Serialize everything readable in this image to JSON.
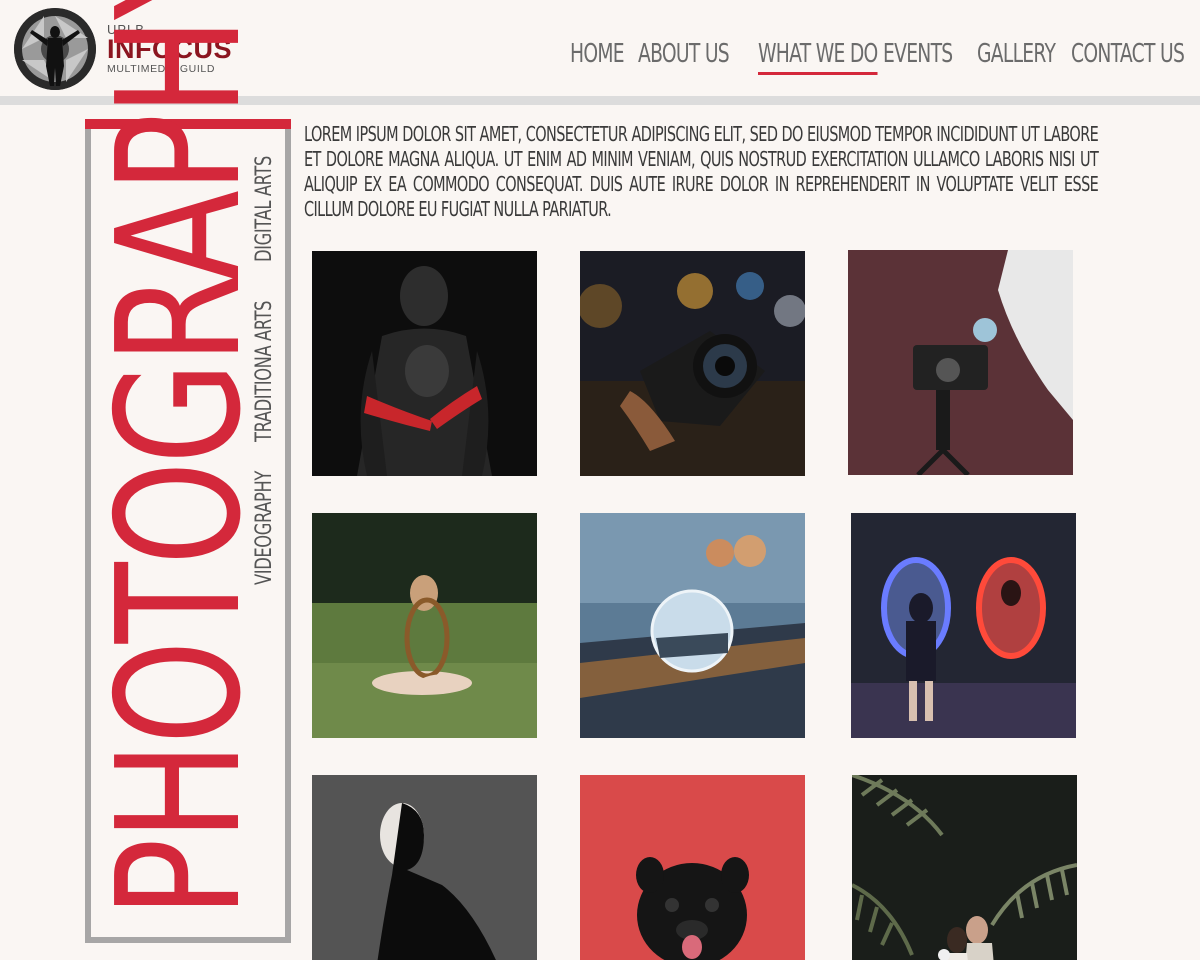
{
  "logo": {
    "line1": "UPLB",
    "line2": "INFOCUS",
    "line3": "MULTIMEDIA GUILD"
  },
  "nav": {
    "items": [
      {
        "label": "HOME",
        "active": false
      },
      {
        "label": "ABOUT US",
        "active": false
      },
      {
        "label": "WHAT WE DO",
        "active": true
      },
      {
        "label": "EVENTS",
        "active": false
      },
      {
        "label": "GALLERY",
        "active": false
      },
      {
        "label": "CONTACT US",
        "active": false
      }
    ]
  },
  "sidebar": {
    "title": "PHOTOGRAPHY",
    "links": [
      "DIGITAL ARTS",
      "TRADITIONA ARTS",
      "VIDEOGRAPHY"
    ]
  },
  "intro": {
    "text": "LOREM IPSUM DOLOR SIT AMET, CONSECTETUR ADIPISCING ELIT, SED DO EIUSMOD TEMPOR INCIDIDUNT UT LABORE ET DOLORE MAGNA ALIQUA. UT ENIM AD MINIM VENIAM, QUIS NOSTRUD EXERCITATION ULLAMCO LABORIS NISI UT ALIQUIP EX EA COMMODO CONSEQUAT. DUIS AUTE IRURE DOLOR IN REPREHENDERIT IN VOLUPTATE VELIT ESSE CILLUM DOLORE EU FUGIAT NULLA PARIATUR."
  },
  "colors": {
    "accent": "#d4283b",
    "brand": "#8b1520",
    "panel_border": "#a7a6a6",
    "background": "#faf6f3"
  },
  "gallery": {
    "photos": [
      {
        "subject": "painted-figure-portrait"
      },
      {
        "subject": "hand-holding-camera"
      },
      {
        "subject": "vintage-camera-on-tripod"
      },
      {
        "subject": "girl-with-mirror-in-grass"
      },
      {
        "subject": "crystal-ball-on-road"
      },
      {
        "subject": "neon-mirror-reflection"
      },
      {
        "subject": "split-shadow-portrait"
      },
      {
        "subject": "pug-on-red-background"
      },
      {
        "subject": "couple-under-ferns"
      }
    ]
  }
}
